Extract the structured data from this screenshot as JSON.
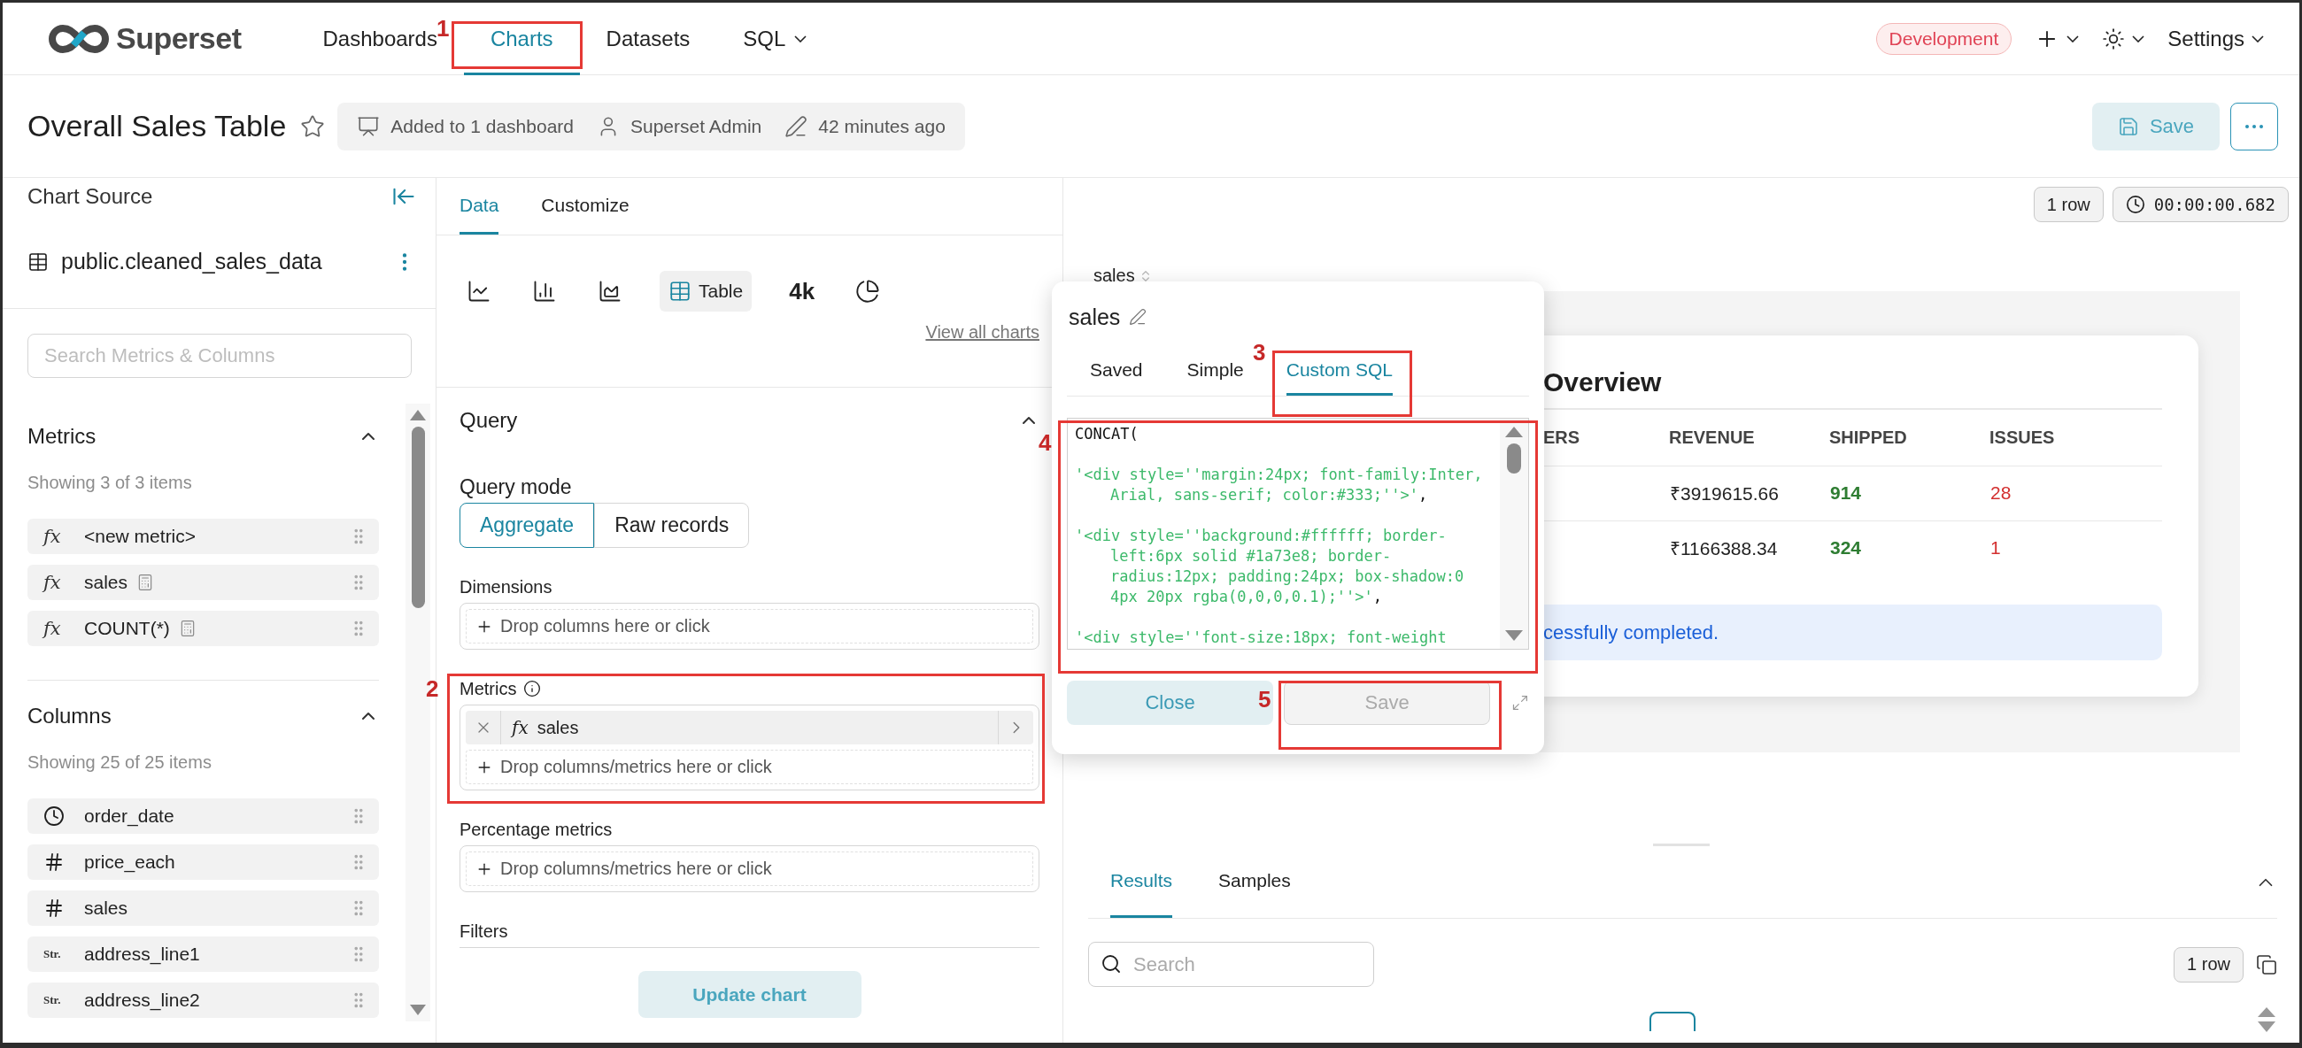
{
  "header": {
    "logo_text": "Superset",
    "nav": [
      {
        "label": "Dashboards",
        "selected": false,
        "dropdown": false
      },
      {
        "label": "Charts",
        "selected": true,
        "dropdown": false
      },
      {
        "label": "Datasets",
        "selected": false,
        "dropdown": false
      },
      {
        "label": "SQL",
        "selected": false,
        "dropdown": true
      }
    ],
    "environment_badge": "Development",
    "settings": "Settings"
  },
  "title_bar": {
    "title": "Overall Sales Table",
    "starred": false,
    "meta": [
      {
        "kind": "dashboards",
        "text": "Added to 1 dashboard"
      },
      {
        "kind": "owner",
        "text": "Superset Admin"
      },
      {
        "kind": "modified",
        "text": "42 minutes ago"
      }
    ],
    "save": "Save"
  },
  "left_panel": {
    "title": "Chart Source",
    "dataset": "public.cleaned_sales_data",
    "search": {
      "placeholder": "Search Metrics & Columns"
    },
    "sections": [
      {
        "title": "Metrics",
        "expanded": true,
        "count": "Showing 3 of 3 items",
        "items": [
          {
            "kind": "metric",
            "badge": "fx",
            "name": "<new metric>",
            "calculated": false
          },
          {
            "kind": "metric",
            "badge": "fx",
            "name": "sales",
            "calculated": true
          },
          {
            "kind": "metric",
            "badge": "fx",
            "name": "COUNT(*)",
            "calculated": true
          }
        ]
      },
      {
        "title": "Columns",
        "expanded": true,
        "count": "Showing 25 of 25 items",
        "items": [
          {
            "kind": "temporal",
            "name": "order_date",
            "calculated": false
          },
          {
            "kind": "numeric",
            "name": "price_each",
            "calculated": false
          },
          {
            "kind": "numeric",
            "name": "sales",
            "calculated": false
          },
          {
            "kind": "string",
            "badge": "Str.",
            "name": "address_line1",
            "calculated": false
          },
          {
            "kind": "string",
            "badge": "Str.",
            "name": "address_line2",
            "calculated": false
          }
        ]
      }
    ]
  },
  "middle_panel": {
    "tabs": [
      {
        "label": "Data",
        "selected": true
      },
      {
        "label": "Customize",
        "selected": false
      }
    ],
    "chart_types": [
      {
        "kind": "line",
        "selected": false
      },
      {
        "kind": "bar",
        "selected": false
      },
      {
        "kind": "area",
        "selected": false
      },
      {
        "kind": "table",
        "label": "Table",
        "selected": true
      },
      {
        "kind": "big_number",
        "label": "4k",
        "selected": false
      },
      {
        "kind": "pie",
        "selected": false
      }
    ],
    "view_all": "View all charts",
    "section": {
      "title": "Query",
      "expanded": true
    },
    "query_mode": {
      "label": "Query mode",
      "options": [
        {
          "label": "Aggregate",
          "selected": true
        },
        {
          "label": "Raw records",
          "selected": false
        }
      ]
    },
    "controls": [
      {
        "label": "Dimensions",
        "info": false,
        "placeholder": "Drop columns here or click"
      },
      {
        "label": "Metrics",
        "info": true,
        "chips": [
          {
            "badge": "fx",
            "name": "sales"
          }
        ],
        "placeholder": "Drop columns/metrics here or click"
      },
      {
        "label": "Percentage metrics",
        "info": false,
        "placeholder": "Drop columns/metrics here or click"
      },
      {
        "label": "Filters",
        "info": false
      }
    ],
    "update_button": "Update chart"
  },
  "chart_area": {
    "row_count": "1 row",
    "timer": "00:00:00.682",
    "column_header": "sales",
    "card": {
      "title": "Overview",
      "columns": [
        {
          "label": "ERS",
          "kind": "plain"
        },
        {
          "label": "REVENUE",
          "kind": "plain"
        },
        {
          "label": "SHIPPED",
          "kind": "good"
        },
        {
          "label": "ISSUES",
          "kind": "bad"
        }
      ],
      "rows": [
        {
          "cells": [
            "",
            "₹3919615.66",
            "914",
            "28"
          ]
        },
        {
          "cells": [
            "",
            "₹1166388.34",
            "324",
            "1"
          ]
        }
      ],
      "banner": "cessfully completed."
    }
  },
  "results_panel": {
    "tabs": [
      {
        "label": "Results",
        "selected": true
      },
      {
        "label": "Samples",
        "selected": false
      }
    ],
    "expanded": true,
    "search": {
      "placeholder": "Search"
    },
    "row_count": "1 row"
  },
  "metric_popover": {
    "title": "sales",
    "tabs": [
      {
        "label": "Saved",
        "selected": false
      },
      {
        "label": "Simple",
        "selected": false
      },
      {
        "label": "Custom SQL",
        "selected": true
      }
    ],
    "sql_lines": [
      {
        "tokens": [
          {
            "kind": "plain",
            "text": "CONCAT("
          }
        ]
      },
      {
        "tokens": [
          {
            "kind": "string",
            "text": "'<div style=''margin:24px; font-family:Inter, Arial, sans-serif; color:#333;''>'"
          },
          {
            "kind": "plain",
            "text": ","
          }
        ]
      },
      {
        "tokens": [
          {
            "kind": "string",
            "text": "'<div style=''background:#ffffff; border-left:6px solid #1a73e8; border-radius:12px; padding:24px; box-shadow:0 4px 20px rgba(0,0,0,0.1);''>'"
          },
          {
            "kind": "plain",
            "text": ","
          }
        ]
      },
      {
        "tokens": [
          {
            "kind": "string",
            "text": "'<div style=''font-size:18px; font-weight"
          }
        ]
      }
    ],
    "buttons": [
      {
        "label": "Close",
        "kind": "secondary",
        "disabled": false
      },
      {
        "label": "Save",
        "kind": "primary",
        "disabled": true
      }
    ]
  },
  "annotations": [
    {
      "label": "1"
    },
    {
      "label": "2"
    },
    {
      "label": "3"
    },
    {
      "label": "4"
    },
    {
      "label": "5"
    }
  ]
}
